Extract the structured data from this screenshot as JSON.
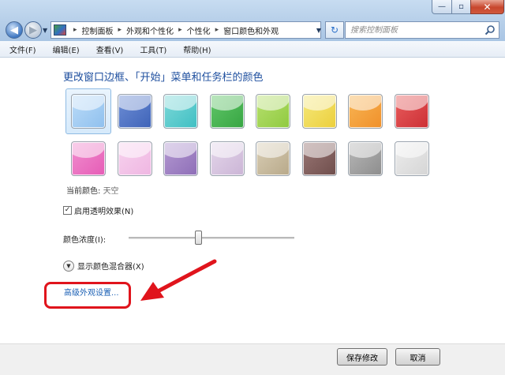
{
  "window": {
    "minimize": "—",
    "maximize": "▫",
    "close": "✕"
  },
  "nav": {
    "back": "◀",
    "forward": "▶",
    "recent": "▼",
    "refresh": "↻"
  },
  "address": {
    "crumbs": [
      "控制面板",
      "外观和个性化",
      "个性化",
      "窗口颜色和外观"
    ],
    "separator": "▸",
    "dropdown": "▼"
  },
  "search": {
    "placeholder": "搜索控制面板"
  },
  "menu": [
    "文件(F)",
    "编辑(E)",
    "查看(V)",
    "工具(T)",
    "帮助(H)"
  ],
  "heading": "更改窗口边框、「开始」菜单和任务栏的颜色",
  "swatches": [
    {
      "name": "sky",
      "color": "#bcdcf8",
      "dark": "#8fc0ee"
    },
    {
      "name": "twilight",
      "color": "#6f8fd6",
      "dark": "#3e63b8"
    },
    {
      "name": "sea",
      "color": "#7fd9d9",
      "dark": "#3fbfc3"
    },
    {
      "name": "leaf",
      "color": "#62c76a",
      "dark": "#36a542"
    },
    {
      "name": "lime",
      "color": "#b8e070",
      "dark": "#8fca3f"
    },
    {
      "name": "lemon",
      "color": "#f5e97c",
      "dark": "#eccf3c"
    },
    {
      "name": "pumpkin",
      "color": "#f8b655",
      "dark": "#f0902a"
    },
    {
      "name": "ruby",
      "color": "#e95e5e",
      "dark": "#cc2f35"
    },
    {
      "name": "fuchsia",
      "color": "#f08fcf",
      "dark": "#e65cb6"
    },
    {
      "name": "blush",
      "color": "#f7d3ee",
      "dark": "#efb6e2"
    },
    {
      "name": "violet",
      "color": "#b49ad2",
      "dark": "#8e6eb7"
    },
    {
      "name": "lavender",
      "color": "#e4d6ea",
      "dark": "#cbb5d6"
    },
    {
      "name": "taupe",
      "color": "#d9ceb5",
      "dark": "#b8a98a"
    },
    {
      "name": "chocolate",
      "color": "#9a7775",
      "dark": "#6f4e4c"
    },
    {
      "name": "slate",
      "color": "#b8b8b8",
      "dark": "#8d8d8d"
    },
    {
      "name": "frost",
      "color": "#ededed",
      "dark": "#d5d5d5"
    }
  ],
  "selected_index": 0,
  "current_color": {
    "label": "当前颜色:",
    "value": "天空"
  },
  "transparency": {
    "label": "启用透明效果(N)",
    "checked": true,
    "mark": "✓"
  },
  "intensity": {
    "label": "颜色浓度(I):",
    "value": 0.42
  },
  "mixer": {
    "label": "显示颜色混合器(X)",
    "chevron": "▼"
  },
  "advanced_link": "高级外观设置...",
  "buttons": {
    "save": "保存修改",
    "cancel": "取消"
  },
  "colors": {
    "accent": "#1d4e9e",
    "link": "#1a5fb4",
    "annotation": "#e0141c"
  }
}
